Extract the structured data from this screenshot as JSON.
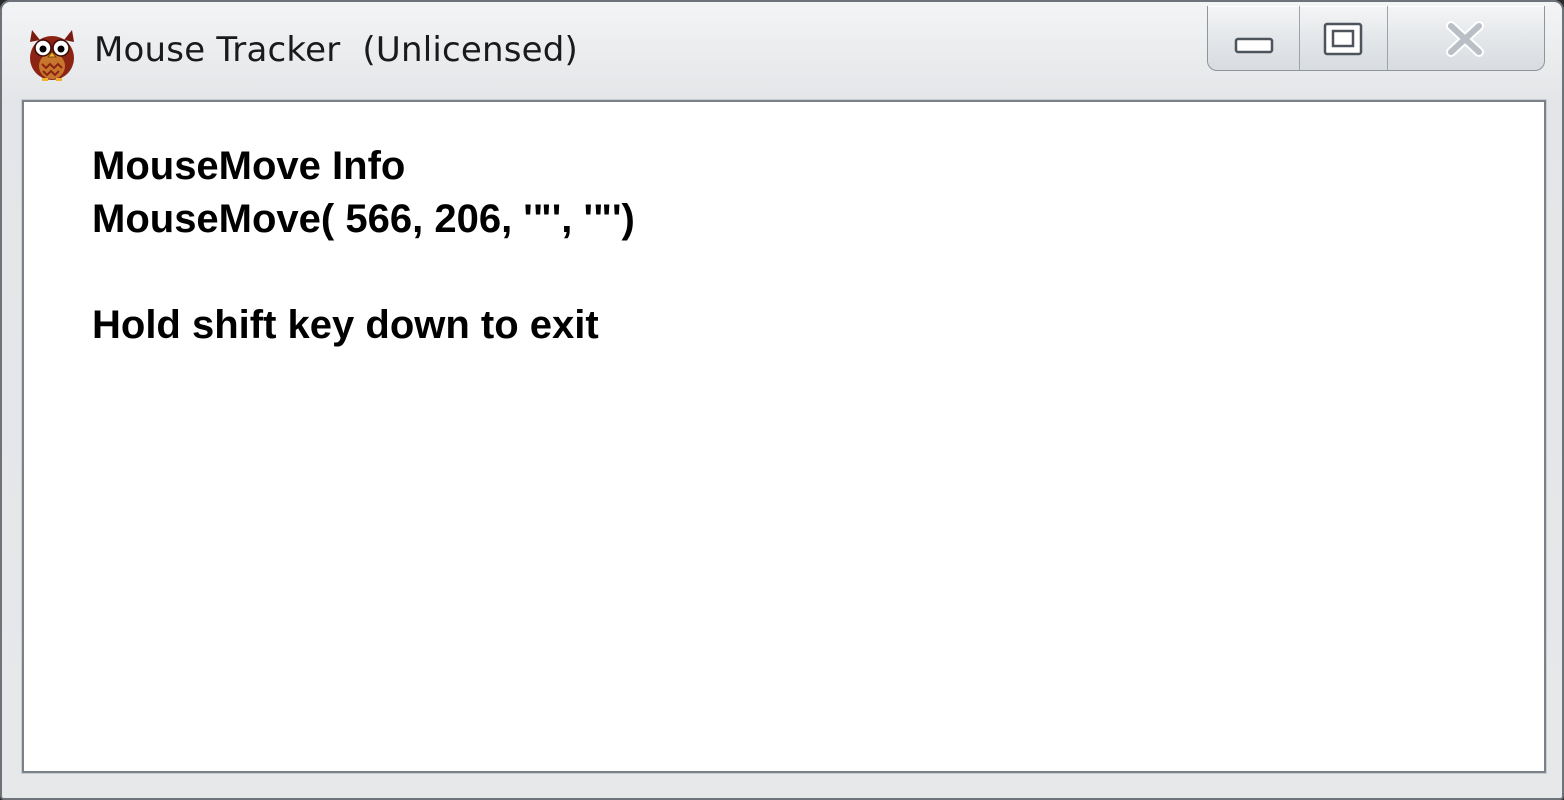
{
  "window": {
    "title": "Mouse Tracker  (Unlicensed)",
    "app_icon": "owl-icon"
  },
  "caption_buttons": {
    "minimize_icon": "minimize-icon",
    "maximize_icon": "maximize-icon",
    "close_icon": "close-icon"
  },
  "content": {
    "heading": "MouseMove Info",
    "command": "MouseMove( 566, 206, '\"', '\"')",
    "instruction": "Hold shift key down to exit"
  },
  "colors": {
    "text": "#000000",
    "client_background": "#ffffff",
    "frame": "#e6e8ea"
  }
}
